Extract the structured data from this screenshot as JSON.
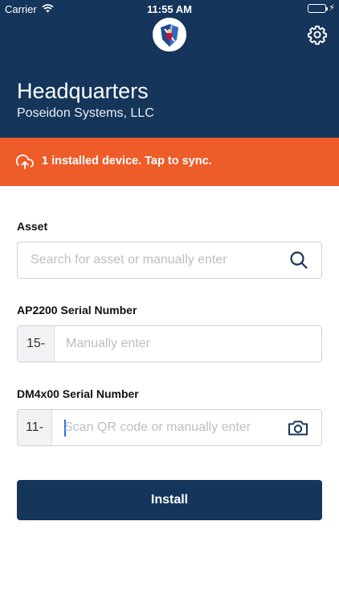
{
  "status_bar": {
    "carrier": "Carrier",
    "time": "11:55 AM"
  },
  "header": {
    "title": "Headquarters",
    "subtitle": "Poseidon Systems, LLC"
  },
  "sync_banner": {
    "text": "1 installed device. Tap to sync."
  },
  "form": {
    "asset": {
      "label": "Asset",
      "placeholder": "Search for asset or manually enter"
    },
    "ap_serial": {
      "label": "AP2200 Serial Number",
      "prefix": "15-",
      "placeholder": "Manually enter"
    },
    "dm_serial": {
      "label": "DM4x00 Serial Number",
      "prefix": "11-",
      "placeholder": "Scan QR code or manually enter"
    }
  },
  "actions": {
    "install_label": "Install"
  },
  "colors": {
    "header": "#15355b",
    "banner": "#ee5c29",
    "button": "#15355b"
  }
}
